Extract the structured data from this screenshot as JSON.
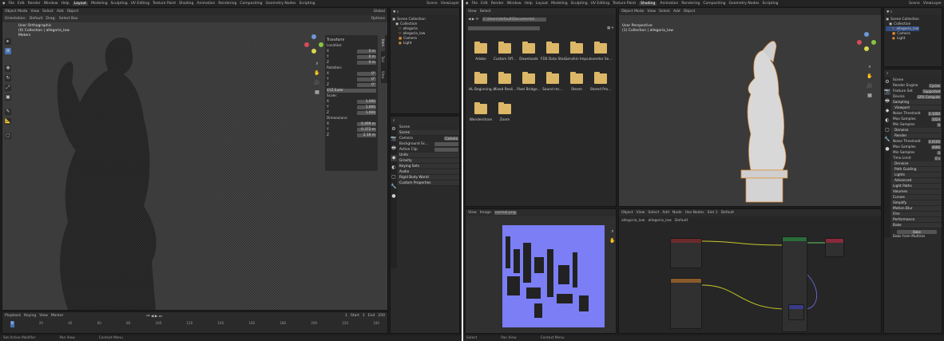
{
  "left_window": {
    "topbar_menus": [
      "File",
      "Edit",
      "Render",
      "Window",
      "Help"
    ],
    "workspace_tabs": [
      "Layout",
      "Modeling",
      "Sculpting",
      "UV Editing",
      "Texture Paint",
      "Shading",
      "Animation",
      "Rendering",
      "Compositing",
      "Geometry Nodes",
      "Scripting"
    ],
    "scene_label": "Scene",
    "viewlayer_label": "ViewLayer",
    "viewport": {
      "header": {
        "editor": "Object Mode",
        "menus": [
          "View",
          "Select",
          "Add",
          "Object"
        ],
        "transform": "Global"
      },
      "subheader": {
        "orientation": "Orientation:",
        "orientation_value": "Default",
        "drag": "Drag:",
        "drag_value": "Select Box",
        "options": "Options"
      },
      "overlay_lines": [
        "User Orthographic",
        "(0) Collection | allegoria_low",
        "Meters"
      ],
      "npanel": {
        "transform_title": "Transform",
        "location_label": "Location:",
        "location": [
          {
            "axis": "X",
            "value": "0 m"
          },
          {
            "axis": "Y",
            "value": "0 m"
          },
          {
            "axis": "Z",
            "value": "0 m"
          }
        ],
        "rotation_label": "Rotation:",
        "rotation": [
          {
            "axis": "X",
            "value": "0°"
          },
          {
            "axis": "Y",
            "value": "0°"
          },
          {
            "axis": "Z",
            "value": "0°"
          }
        ],
        "rotation_mode": "XYZ Euler",
        "scale_label": "Scale:",
        "scale": [
          {
            "axis": "X",
            "value": "1.000"
          },
          {
            "axis": "Y",
            "value": "1.000"
          },
          {
            "axis": "Z",
            "value": "1.000"
          }
        ],
        "dimensions_label": "Dimensions:",
        "dimensions": [
          {
            "axis": "X",
            "value": "0.499 m"
          },
          {
            "axis": "Y",
            "value": "0.372 m"
          },
          {
            "axis": "Z",
            "value": "2.16 m"
          }
        ],
        "tabs": [
          "Item",
          "Tool",
          "View"
        ]
      }
    },
    "timeline": {
      "menus": [
        "Playback",
        "Keying",
        "View",
        "Marker"
      ],
      "current_frame": "1",
      "start_label": "Start",
      "start": "1",
      "end_label": "End",
      "end": "250",
      "ticks": [
        "0",
        "20",
        "40",
        "60",
        "80",
        "100",
        "120",
        "140",
        "160",
        "180",
        "200",
        "220",
        "240"
      ]
    },
    "status": [
      "Set Active Modifier",
      "Pan View",
      "Context Menu"
    ],
    "outliner": {
      "title": "Scene Collection",
      "rows": [
        "Collection",
        "allegoria",
        "allegoria_low",
        "Camera",
        "Light"
      ]
    },
    "properties": {
      "search": "",
      "scene_name": "Scene",
      "sections": [
        "Scene"
      ],
      "camera_label": "Camera",
      "camera_value": "Camera",
      "background_scene_label": "Background Sc...",
      "active_clip_label": "Active Clip",
      "collapsed": [
        "Units",
        "Gravity",
        "Keying Sets",
        "Audio",
        "Rigid Body World",
        "Custom Properties"
      ]
    }
  },
  "right_window": {
    "topbar_menus": [
      "File",
      "Edit",
      "Render",
      "Window",
      "Help"
    ],
    "workspace_tabs": [
      "Layout",
      "Modeling",
      "Sculpting",
      "UV Editing",
      "Texture Paint",
      "Shading",
      "Animation",
      "Rendering",
      "Compositing",
      "Geometry Nodes",
      "Scripting"
    ],
    "active_tab": "Shading",
    "scene_label": "Scene",
    "viewlayer_label": "ViewLayer",
    "file_browser": {
      "menus": [
        "View",
        "Select"
      ],
      "path": "C:\\Users\\default\\Documents\\",
      "folders": [
        {
          "name": "Adobe"
        },
        {
          "name": "Custom Off..."
        },
        {
          "name": "Downloads"
        },
        {
          "name": "FDS Data Stor..."
        },
        {
          "name": "Genshin Impa..."
        },
        {
          "name": "Inventor Se..."
        },
        {
          "name": "HL Beginning..."
        },
        {
          "name": "Mixed Reali..."
        },
        {
          "name": "Pixel Bridge..."
        },
        {
          "name": "Sound rec..."
        },
        {
          "name": "Steam"
        },
        {
          "name": "Stored Pro..."
        },
        {
          "name": "Wondershare"
        },
        {
          "name": "Zoom"
        }
      ]
    },
    "viewport": {
      "menus": [
        "View",
        "Select",
        "Add",
        "Object"
      ],
      "mode": "Object Mode",
      "overlay_lines": [
        "User Perspective",
        "(1) Collection | allegoria_low"
      ]
    },
    "image_editor": {
      "menus": [
        "View",
        "Image"
      ],
      "image_name": "normal.png"
    },
    "node_editor": {
      "menus": [
        "View",
        "Select",
        "Add",
        "Node"
      ],
      "use_nodes": "Use Nodes",
      "object": "Object",
      "slot": "Slot 1",
      "material": "Default",
      "breadcrumb": [
        "allegoria_low",
        "allegoria_low",
        "Default"
      ]
    },
    "outliner": {
      "title": "Scene Collection",
      "rows": [
        "Collection",
        "allegoria_low",
        "Camera",
        "Light"
      ]
    },
    "properties": {
      "scene_name": "Scene",
      "render_engine_label": "Render Engine",
      "render_engine": "Cycles",
      "feature_set_label": "Feature Set",
      "feature_set": "Supported",
      "device_label": "Device",
      "device": "GPU Compute",
      "sections": [
        "Sampling",
        "Viewport",
        "Noise Threshold",
        "Max Samples",
        "Min Samples",
        "Denoise",
        "Render",
        "Noise Threshold",
        "Max Samples",
        "Min Samples",
        "Time Limit",
        "Denoise",
        "Path Guiding",
        "Lights",
        "Advanced",
        "Light Paths",
        "Volumes",
        "Curves",
        "Simplify",
        "Motion Blur",
        "Film",
        "Performance",
        "Bake"
      ],
      "viewport_noise": "0.1000",
      "viewport_max": "1024",
      "viewport_min": "0",
      "render_noise": "0.0100",
      "render_max": "4096",
      "render_min": "0",
      "time_limit": "0 s",
      "bake_button": "Bake",
      "bake_from_multires": "Bake from Multires"
    },
    "status": [
      "Select",
      "Pan View",
      "Context Menu"
    ]
  }
}
